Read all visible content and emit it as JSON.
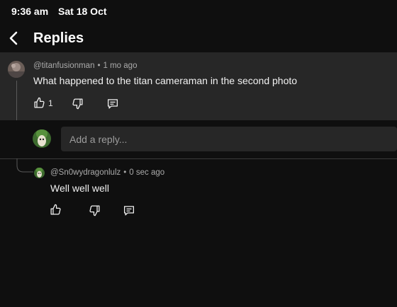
{
  "status_bar": {
    "time": "9:36 am",
    "date": "Sat 18 Oct"
  },
  "header": {
    "title": "Replies",
    "back_icon": "chevron-left-icon"
  },
  "comment": {
    "author": "@titanfusionman",
    "separator": "•",
    "age": "1 mo ago",
    "text": "What happened to the titan cameraman in the second photo",
    "likes": "1"
  },
  "reply_input": {
    "placeholder": "Add a reply..."
  },
  "reply": {
    "author": "@Sn0wydragonlulz",
    "separator": "•",
    "age": "0 sec ago",
    "text": "Well well well"
  },
  "colors": {
    "background": "#0f0f0f",
    "card": "#272727",
    "text": "#f1f1f1",
    "meta": "#aaaaaa"
  }
}
